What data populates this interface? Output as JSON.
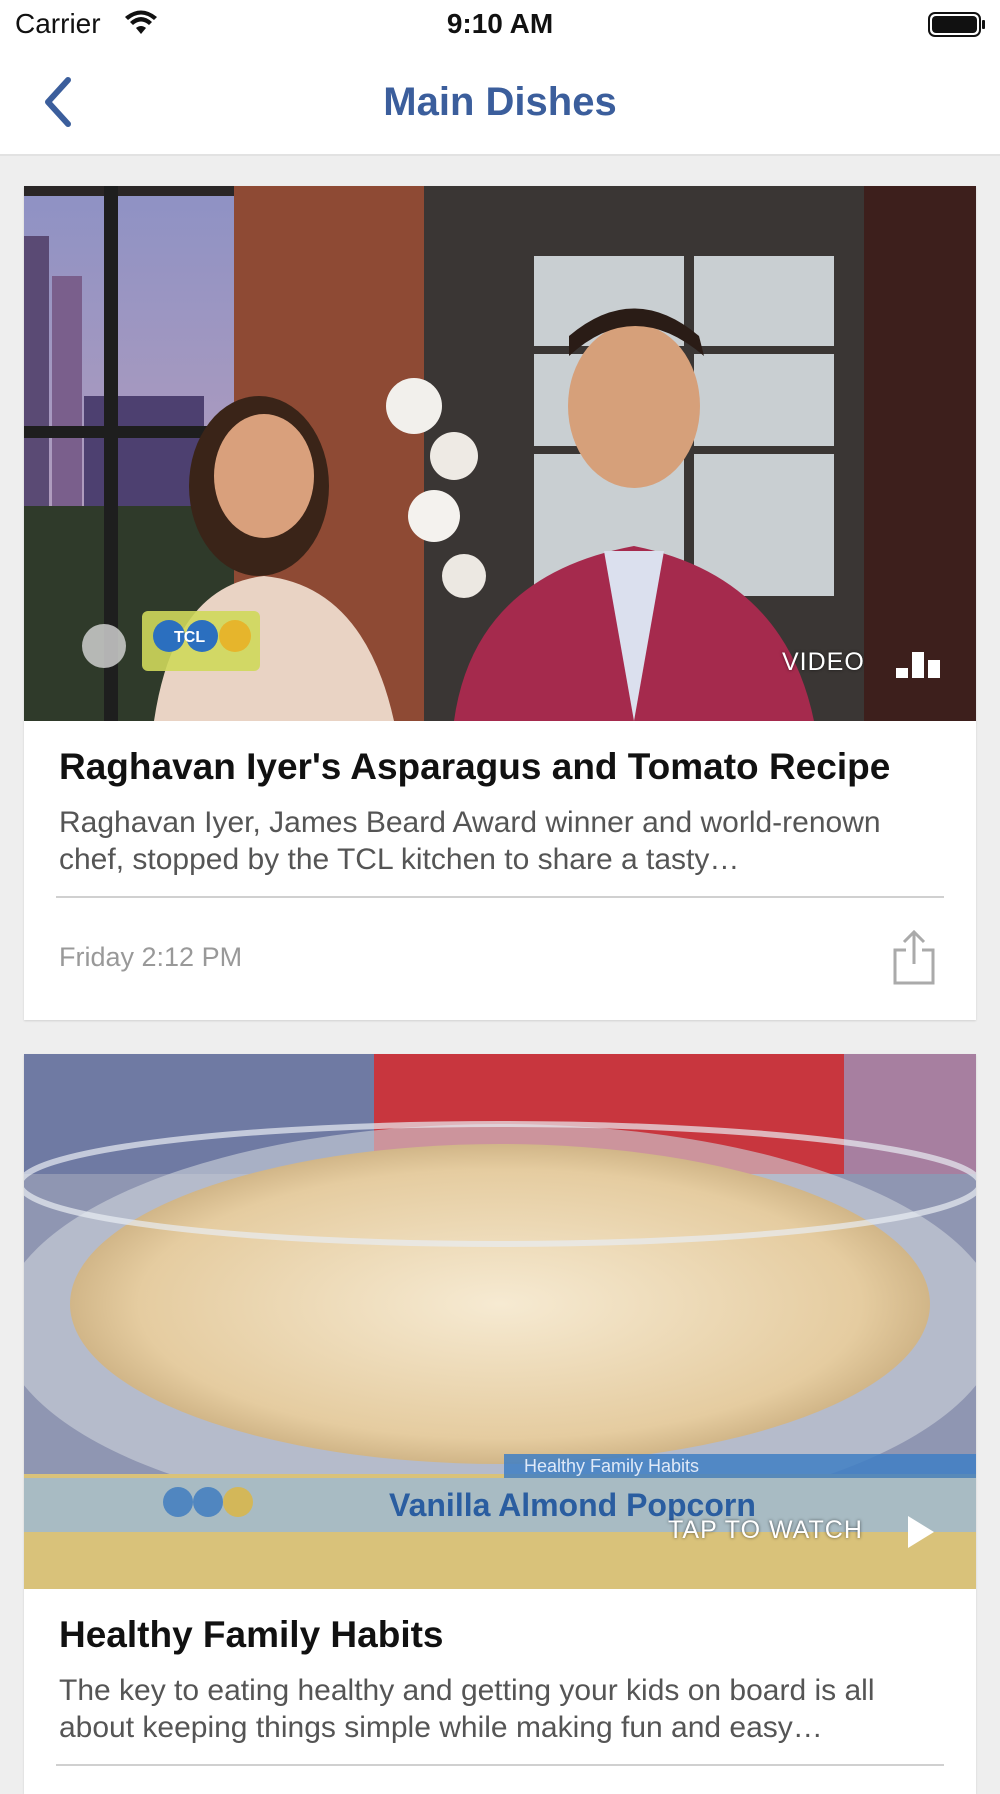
{
  "status_bar": {
    "carrier": "Carrier",
    "time": "9:10 AM",
    "wifi_icon": "wifi-icon",
    "battery_icon": "battery-full-icon"
  },
  "nav": {
    "title": "Main Dishes",
    "back_icon": "chevron-left-icon",
    "accent_color": "#3b5e9c"
  },
  "cards": [
    {
      "media_label": "VIDEO",
      "media_icon": "bar-chart-icon",
      "overlay_logo": "TCL",
      "title": "Raghavan Iyer's Asparagus and Tomato Recipe",
      "description": "Raghavan Iyer, James Beard Award winner and world-renown chef, stopped by the TCL kitchen to share a tasty…",
      "timestamp": "Friday 2:12 PM",
      "share_icon": "share-icon"
    },
    {
      "media_label": "TAP TO WATCH",
      "media_icon": "play-icon",
      "overlay_logo": "TCL",
      "overlay_banner_top": "Healthy Family Habits",
      "overlay_banner_main": "Vanilla Almond Popcorn",
      "title": "Healthy Family Habits",
      "description": "The key to eating healthy and getting your kids on board is all about keeping things simple while making fun and easy…"
    }
  ]
}
